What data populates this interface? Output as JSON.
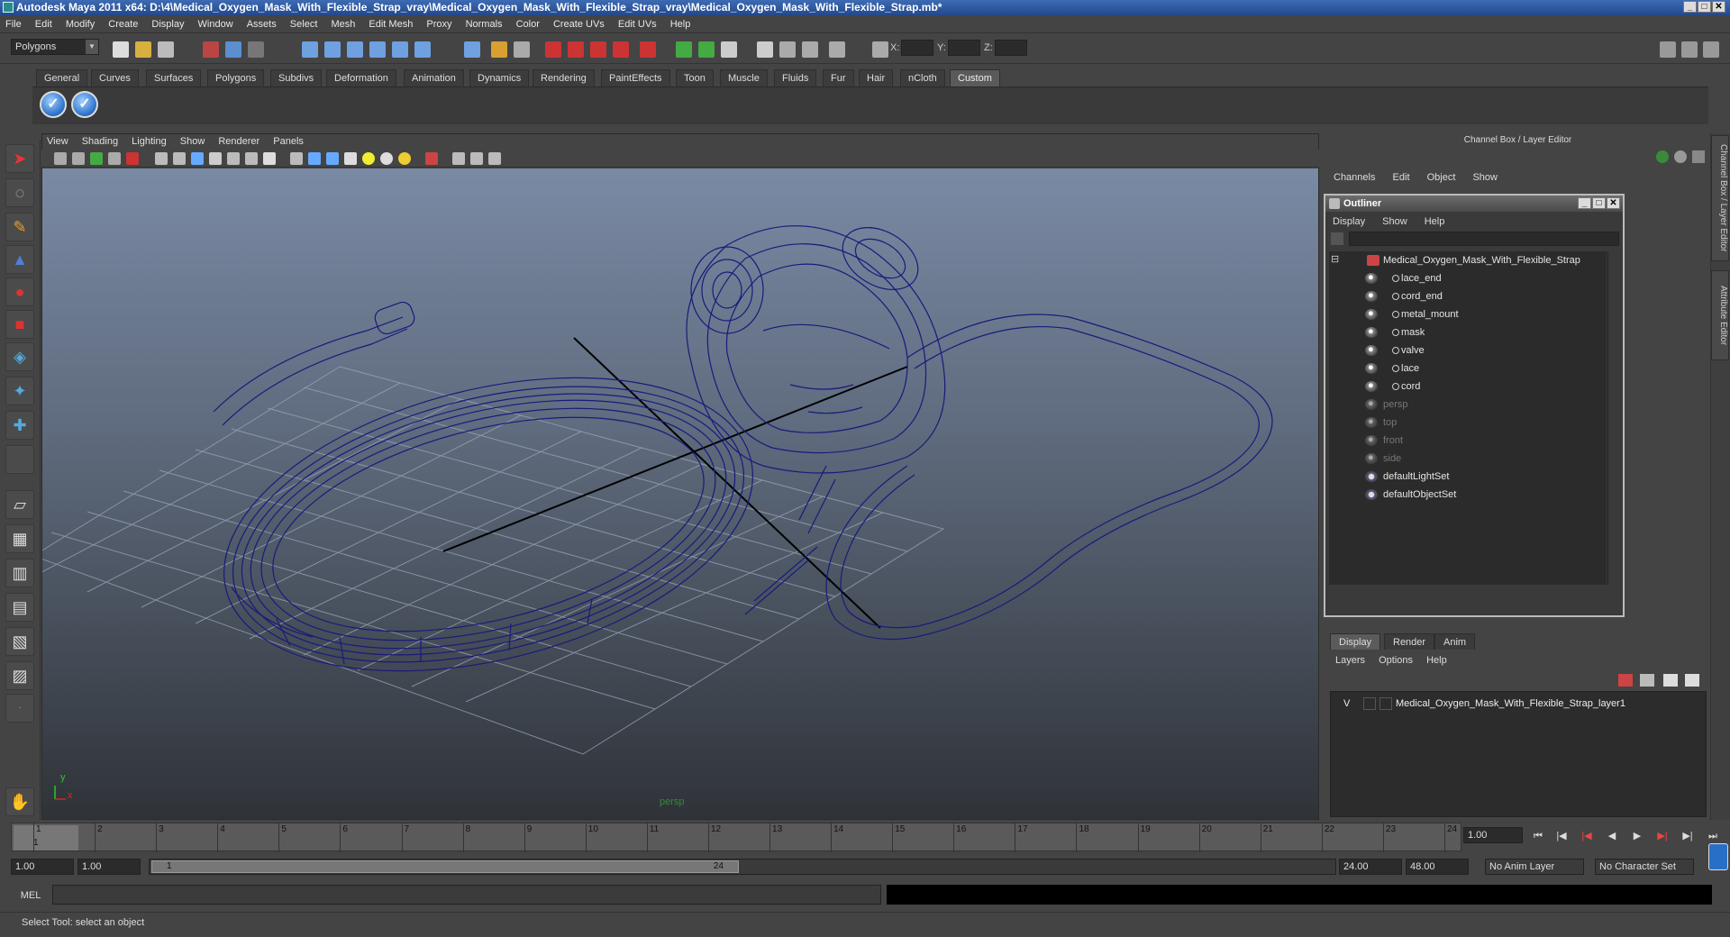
{
  "window": {
    "title": "Autodesk Maya 2011 x64: D:\\4\\Medical_Oxygen_Mask_With_Flexible_Strap_vray\\Medical_Oxygen_Mask_With_Flexible_Strap_vray\\Medical_Oxygen_Mask_With_Flexible_Strap.mb*",
    "min": "_",
    "max": "□",
    "close": "✕"
  },
  "menubar": [
    "File",
    "Edit",
    "Modify",
    "Create",
    "Display",
    "Window",
    "Assets",
    "Select",
    "Mesh",
    "Edit Mesh",
    "Proxy",
    "Normals",
    "Color",
    "Create UVs",
    "Edit UVs",
    "Help"
  ],
  "statusline": {
    "mode": "Polygons",
    "x_label": "X:",
    "y_label": "Y:",
    "z_label": "Z:"
  },
  "shelf": {
    "tabs": [
      "General",
      "Curves",
      "Surfaces",
      "Polygons",
      "Subdivs",
      "Deformation",
      "Animation",
      "Dynamics",
      "Rendering",
      "PaintEffects",
      "Toon",
      "Muscle",
      "Fluids",
      "Fur",
      "Hair",
      "nCloth",
      "Custom"
    ],
    "active_tab": "Custom",
    "check_glyph": "✓"
  },
  "viewport": {
    "menu": [
      "View",
      "Shading",
      "Lighting",
      "Show",
      "Renderer",
      "Panels"
    ],
    "camera_label": "persp",
    "axis_y": "y",
    "axis_x": "x"
  },
  "channel_box": {
    "title": "Channel Box / Layer Editor",
    "menu": [
      "Channels",
      "Edit",
      "Object",
      "Show"
    ],
    "side_tabs": [
      "Channel Box / Layer Editor",
      "Attribute Editor"
    ]
  },
  "outliner": {
    "title": "Outliner",
    "menu": [
      "Display",
      "Show",
      "Help"
    ],
    "collapse_glyph": "⊟",
    "items": [
      {
        "label": "Medical_Oxygen_Mask_With_Flexible_Strap",
        "dim": false
      },
      {
        "label": "lace_end",
        "dim": false
      },
      {
        "label": "cord_end",
        "dim": false
      },
      {
        "label": "metal_mount",
        "dim": false
      },
      {
        "label": "mask",
        "dim": false
      },
      {
        "label": "valve",
        "dim": false
      },
      {
        "label": "lace",
        "dim": false
      },
      {
        "label": "cord",
        "dim": false
      },
      {
        "label": "persp",
        "dim": true
      },
      {
        "label": "top",
        "dim": true
      },
      {
        "label": "front",
        "dim": true
      },
      {
        "label": "side",
        "dim": true
      },
      {
        "label": "defaultLightSet",
        "dim": false
      },
      {
        "label": "defaultObjectSet",
        "dim": false
      }
    ]
  },
  "layers": {
    "tabs": [
      "Display",
      "Render",
      "Anim"
    ],
    "active_tab": "Display",
    "menu": [
      "Layers",
      "Options",
      "Help"
    ],
    "rows": [
      {
        "visible": "V",
        "name": "Medical_Oxygen_Mask_With_Flexible_Strap_layer1"
      }
    ]
  },
  "timeline": {
    "ticks": [
      "1",
      "2",
      "3",
      "4",
      "5",
      "6",
      "7",
      "8",
      "9",
      "10",
      "11",
      "12",
      "13",
      "14",
      "15",
      "16",
      "17",
      "18",
      "19",
      "20",
      "21",
      "22",
      "23",
      "24"
    ],
    "current_marker": "1",
    "current_frame": "1.00"
  },
  "range": {
    "start_time": "1.00",
    "playback_start": "1.00",
    "slider_start": "1",
    "slider_end": "24",
    "playback_end": "24.00",
    "end_time": "48.00",
    "anim_layer": "No Anim Layer",
    "character_set": "No Character Set"
  },
  "command_line": {
    "label": "MEL"
  },
  "help_line": "Select Tool: select an object",
  "colors": {
    "wireframe": "#1a1a7a",
    "accent_blue": "#2b5aa8",
    "viewport_top": "#7a8aa4",
    "viewport_bottom": "#2f3338"
  }
}
